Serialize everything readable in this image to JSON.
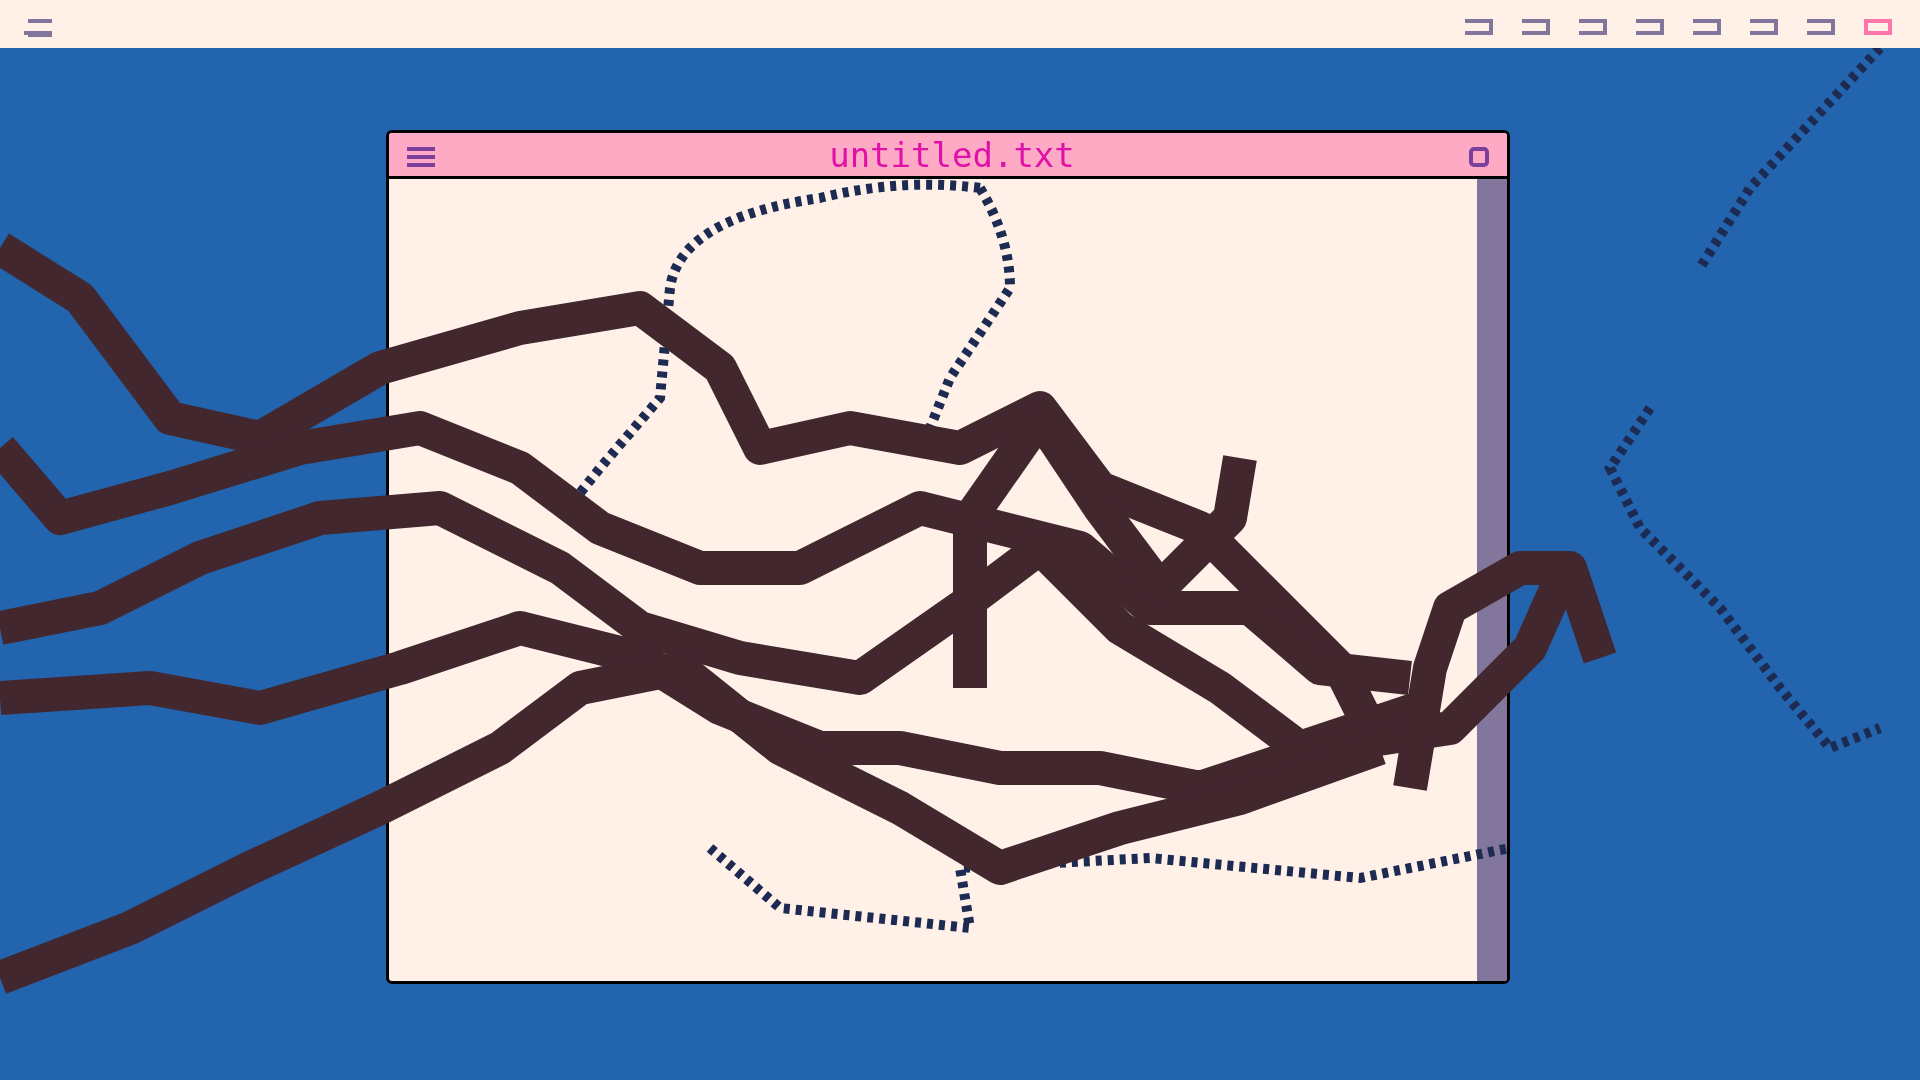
{
  "top_bar": {
    "workspaces": [
      {
        "selected": false
      },
      {
        "selected": false
      },
      {
        "selected": false
      },
      {
        "selected": false
      },
      {
        "selected": false
      },
      {
        "selected": false
      },
      {
        "selected": false
      },
      {
        "selected": true
      }
    ]
  },
  "window": {
    "title": "untitled.txt"
  }
}
